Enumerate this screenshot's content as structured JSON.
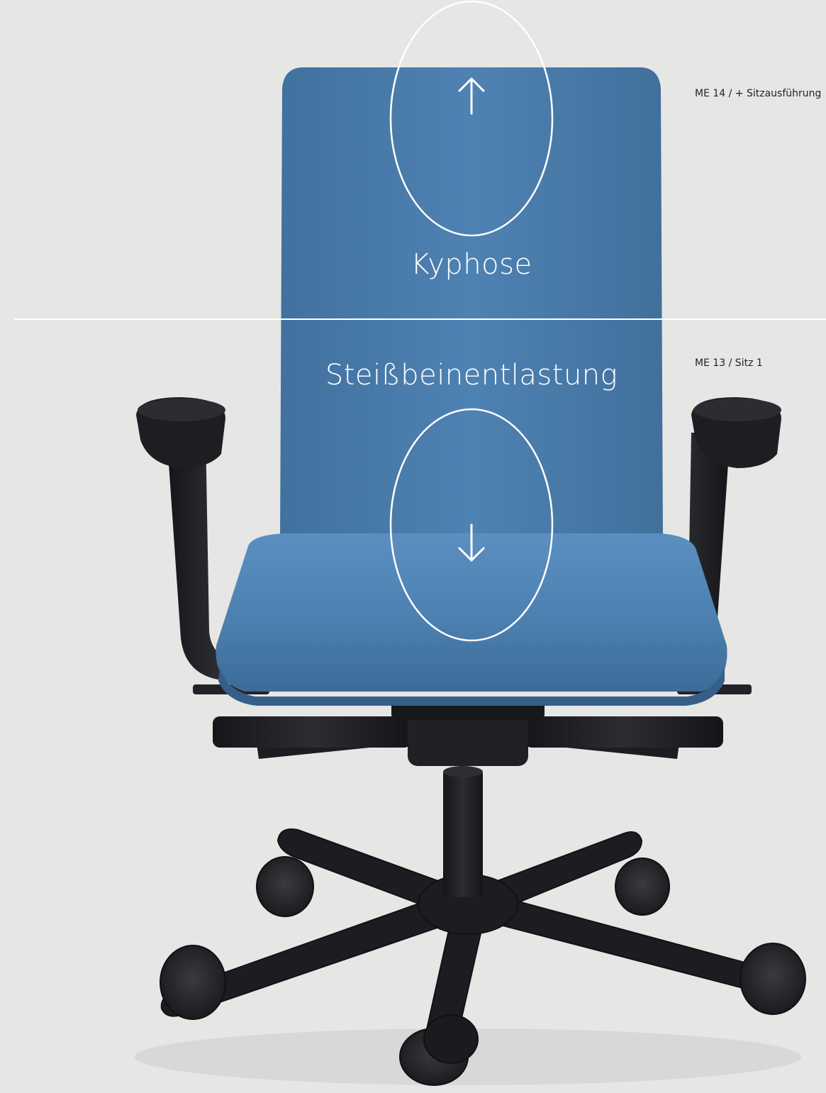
{
  "annotations": {
    "upper_zone_label": "Kyphose",
    "lower_zone_label": "Steißbeinentlastung",
    "upper_arrow_icon": "arrow-up-icon",
    "lower_arrow_icon": "arrow-down-icon"
  },
  "side_labels": {
    "top": "ME 14 / + Sitzausführung",
    "middle": "ME 13 / Sitz 1"
  },
  "colors": {
    "background": "#e6e6e5",
    "upholstery": "#4c7fae",
    "frame": "#1e1f21",
    "overlay": "#ffffff"
  }
}
